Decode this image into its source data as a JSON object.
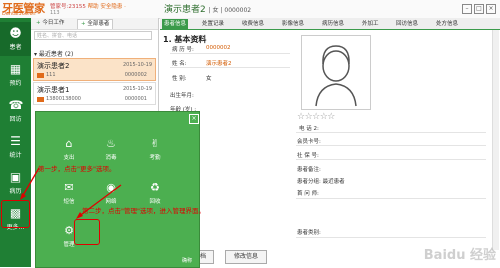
{
  "header": {
    "logo": "牙医管家",
    "logo_sub": "Dental360.cn",
    "account": "管家号:23155",
    "account_note": "帮助 安全隐患 ·",
    "account_sub": "113",
    "patient_title": "演示患者2",
    "patient_title_sub": "| 女 | 0000002",
    "min_label": "–",
    "max_label": "□",
    "close_label": "×"
  },
  "nav": {
    "items": [
      {
        "label": "患者",
        "icon": "user-icon"
      },
      {
        "label": "预约",
        "icon": "calendar-icon"
      },
      {
        "label": "回访",
        "icon": "phone-icon"
      },
      {
        "label": "统计",
        "icon": "chart-icon"
      },
      {
        "label": "病历",
        "icon": "folder-icon"
      },
      {
        "label": "更多...",
        "icon": "grid-icon"
      }
    ]
  },
  "list": {
    "tabs": [
      "今日工作",
      "全部患者"
    ],
    "search_placeholder": "姓名、拼音、电话",
    "section": "最近患者 (2)",
    "patients": [
      {
        "name": "演示患者2",
        "date": "2015-10-19",
        "id": "111",
        "no": "0000002"
      },
      {
        "name": "演示患者1",
        "date": "2015-10-19",
        "id": "13800138000",
        "no": "0000001"
      }
    ]
  },
  "detail": {
    "tabs": [
      "患者信息",
      "处置记录",
      "收费信息",
      "影像信息",
      "病历信息",
      "外加工",
      "回访信息",
      "处方信息"
    ],
    "section_title": "1. 基本资料",
    "fields": {
      "record_label": "病 历 号:",
      "record_value": "0000002",
      "name_label": "姓    名:",
      "name_value": "演示患者2",
      "gender_label": "性    别:",
      "gender_value": "女",
      "birth_label": "出生年月:",
      "age_label": "年龄 (岁) :"
    },
    "right_fields": [
      "电    话 2:",
      "会员卡号:",
      "社 保 号:",
      "患者备注:",
      "患者分组: 最近患者",
      "首 问 师:",
      "患者类别:"
    ],
    "bottom_buttons": [
      "归档",
      "修改信息"
    ]
  },
  "popup": {
    "items": [
      {
        "label": "支出",
        "icon": "home-icon"
      },
      {
        "label": "消毒",
        "icon": "sterilize-icon"
      },
      {
        "label": "考勤",
        "icon": "attendance-icon"
      },
      {
        "label": "短信",
        "icon": "sms-icon"
      },
      {
        "label": "网络",
        "icon": "network-icon"
      },
      {
        "label": "回收",
        "icon": "recycle-icon"
      },
      {
        "label": "管理",
        "icon": "gear-icon"
      }
    ],
    "corner_label": "确称"
  },
  "annotations": {
    "step1": "第一步，点击\"更多\"选项。",
    "step2": "第二步，点击\"管理\"选项，进入管理界面。"
  },
  "watermark": "Baidu 经验",
  "colors": {
    "nav_green": "#1f7f34",
    "popup_green": "#4caf50",
    "accent_orange": "#e06a1a",
    "annotation_red": "#e00000"
  }
}
